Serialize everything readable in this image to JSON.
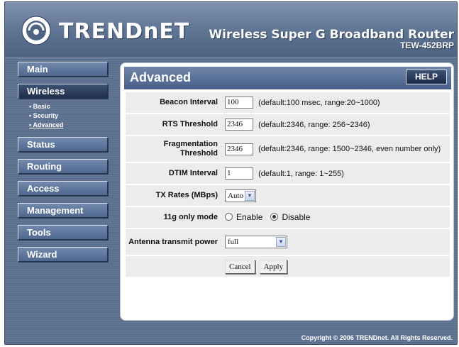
{
  "header": {
    "logo_text": "TRENDnET",
    "product_title": "Wireless Super G Broadband Router",
    "model": "TEW-452BRP"
  },
  "sidebar": {
    "items": [
      {
        "label": "Main"
      },
      {
        "label": "Wireless",
        "active": true,
        "subitems": [
          {
            "label": "Basic"
          },
          {
            "label": "Security"
          },
          {
            "label": "Advanced",
            "active": true
          }
        ]
      },
      {
        "label": "Status"
      },
      {
        "label": "Routing"
      },
      {
        "label": "Access"
      },
      {
        "label": "Management"
      },
      {
        "label": "Tools"
      },
      {
        "label": "Wizard"
      }
    ]
  },
  "content": {
    "title": "Advanced",
    "help_label": "HELP",
    "fields": {
      "beacon": {
        "label": "Beacon Interval",
        "value": "100",
        "hint": "(default:100 msec, range:20~1000)"
      },
      "rts": {
        "label": "RTS Threshold",
        "value": "2346",
        "hint": "(default:2346, range: 256~2346)"
      },
      "frag": {
        "label": "Fragmentation Threshold",
        "value": "2346",
        "hint": "(default:2346, range: 1500~2346, even number only)"
      },
      "dtim": {
        "label": "DTIM Interval",
        "value": "1",
        "hint": "(default:1, range: 1~255)"
      },
      "tx": {
        "label": "TX Rates (MBps)",
        "value": "Auto"
      },
      "g11": {
        "label": "11g only mode",
        "enable": "Enable",
        "disable": "Disable",
        "selected": "Disable"
      },
      "antenna": {
        "label": "Antenna transmit power",
        "value": "full"
      }
    },
    "cancel_label": "Cancel",
    "apply_label": "Apply"
  },
  "footer": {
    "copyright": "Copyright © 2006 TRENDnet. All Rights Reserved."
  },
  "colors": {
    "frame": "#5a6f8e",
    "nav_button": "#5f77a0",
    "row_background": "#ececec"
  }
}
